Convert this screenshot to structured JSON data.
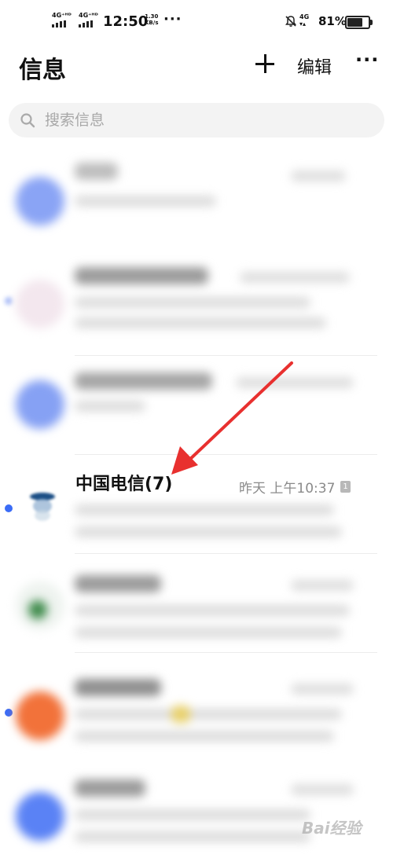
{
  "status_bar": {
    "sim1": "4G⁺ᴴᴰ",
    "sim2": "4G⁺ᴴᴰ",
    "time": "12:50",
    "speed_value": "1.30",
    "speed_unit": "KB/s",
    "more": "···",
    "network": "4G",
    "battery_percent": "81%",
    "battery_level": 0.81
  },
  "header": {
    "title": "信息",
    "add_label": "+",
    "edit_label": "编辑",
    "more_label": "···"
  },
  "search": {
    "placeholder": "搜索信息"
  },
  "conversation": {
    "name": "中国电信(7)",
    "time": "昨天 上午10:37",
    "sim_badge": "1"
  },
  "colors": {
    "accent": "#3b6cf6",
    "arrow": "#e8302f"
  },
  "watermark": "Bai经验"
}
